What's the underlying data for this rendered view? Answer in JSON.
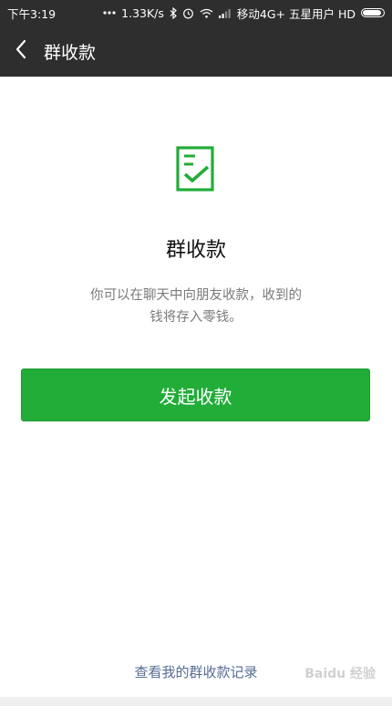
{
  "status_bar": {
    "time": "下午3:19",
    "network_speed": "1.33K/s",
    "carrier": "移动4G+ 五星用户 HD",
    "icons": [
      "more-dots-icon",
      "bluetooth-icon",
      "alarm-icon",
      "wifi-icon",
      "signal-icon",
      "battery-icon"
    ]
  },
  "nav": {
    "title": "群收款",
    "back_icon": "back-arrow-icon"
  },
  "main": {
    "icon": "receipt-check-icon",
    "title": "群收款",
    "description_line1": "你可以在聊天中向朋友收款，收到的",
    "description_line2": "钱将存入零钱。",
    "button_label": "发起收款",
    "history_link": "查看我的群收款记录"
  },
  "colors": {
    "header_bg": "#2e2e2e",
    "accent_green": "#22ac38",
    "link_blue": "#576b95"
  }
}
